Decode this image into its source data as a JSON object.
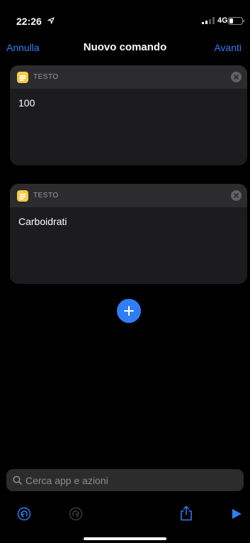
{
  "status_bar": {
    "time": "22:26",
    "network": "4G",
    "icons": [
      "location-arrow-icon",
      "signal-icon",
      "battery-icon"
    ]
  },
  "nav": {
    "cancel_label": "Annulla",
    "title": "Nuovo comando",
    "next_label": "Avanti"
  },
  "actions": [
    {
      "type_label": "TESTO",
      "value": "100",
      "icon": "text-note-icon"
    },
    {
      "type_label": "TESTO",
      "value": "Carboidrati",
      "icon": "text-note-icon"
    }
  ],
  "add_button": {
    "icon": "plus-icon"
  },
  "search": {
    "placeholder": "Cerca app e azioni",
    "value": ""
  },
  "toolbar": {
    "icons": [
      "undo-icon",
      "redo-icon",
      "share-icon",
      "play-icon"
    ]
  },
  "colors": {
    "accent": "#2f7ef5",
    "card_background": "#1c1c1e",
    "card_header": "#2c2c2e",
    "text_action_icon": "#f7cd46",
    "background": "#000000"
  }
}
